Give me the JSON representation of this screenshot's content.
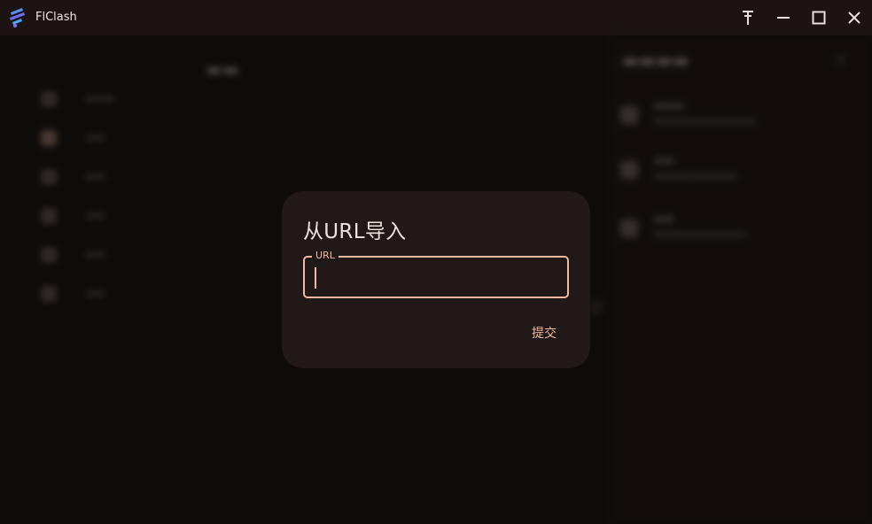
{
  "window": {
    "app_title": "FlClash",
    "controls": {
      "pin_icon": "pin-icon",
      "minimize_icon": "minimize-icon",
      "maximize_icon": "maximize-icon",
      "close_icon": "close-icon"
    }
  },
  "dialog": {
    "title": "从URL导入",
    "url_field": {
      "label": "URL",
      "value": "",
      "placeholder": ""
    },
    "submit_label": "提交"
  },
  "colors": {
    "background": "#140f0e",
    "titlebar": "#1b1413",
    "dialog": "#211917",
    "accent": "#f2b8a0",
    "text": "#eee3df"
  }
}
